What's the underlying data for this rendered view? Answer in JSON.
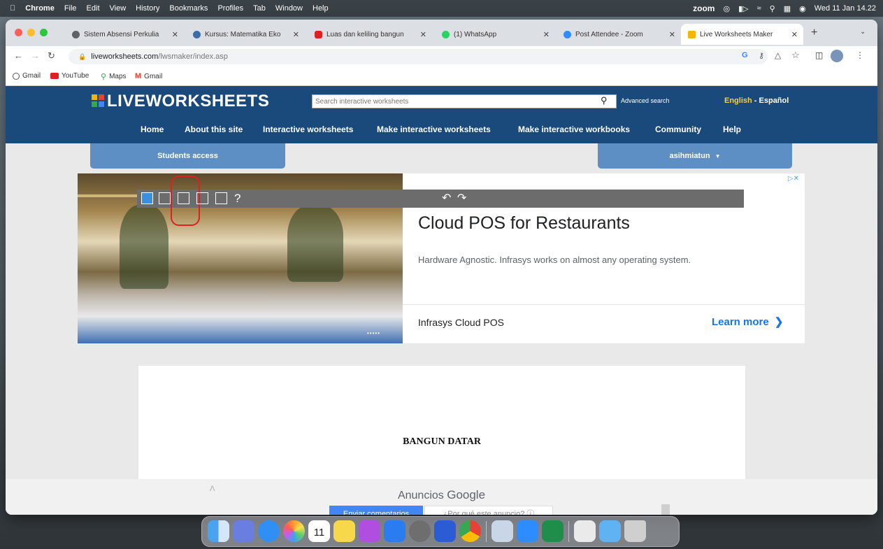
{
  "menubar": {
    "app": "Chrome",
    "items": [
      "File",
      "Edit",
      "View",
      "History",
      "Bookmarks",
      "Profiles",
      "Tab",
      "Window",
      "Help"
    ],
    "zoom_label": "zoom",
    "datetime": "Wed 11 Jan 14.22"
  },
  "tabs": [
    {
      "label": "Sistem Absensi Perkulia",
      "icon_color": "#5f6368"
    },
    {
      "label": "Kursus: Matematika Eko",
      "icon_color": "#3b6ea8"
    },
    {
      "label": "Luas dan keliling bangun",
      "icon_color": "#e02020"
    },
    {
      "label": "(1) WhatsApp",
      "icon_color": "#25d366"
    },
    {
      "label": "Post Attendee - Zoom",
      "icon_color": "#2d8cff"
    },
    {
      "label": "Live Worksheets Maker",
      "icon_color": "#f7b500",
      "active": true
    }
  ],
  "address": {
    "host": "liveworksheets.com",
    "path": "/lwsmaker/index.asp"
  },
  "bookmarks": [
    "Gmail",
    "YouTube",
    "Maps",
    "Gmail"
  ],
  "site": {
    "logo": "LIVEWORKSHEETS",
    "search_placeholder": "Search interactive worksheets",
    "advanced_search": "Advanced search",
    "lang_english": "English",
    "lang_sep": " - ",
    "lang_spanish": "Español",
    "nav": [
      "Home",
      "About this site",
      "Interactive worksheets",
      "Make interactive worksheets",
      "Make interactive workbooks",
      "Community",
      "Help"
    ],
    "students_access": "Students access",
    "user": "asihmiatun"
  },
  "ad": {
    "headline": "Cloud POS for Restaurants",
    "body": "Hardware Agnostic. Infrasys works on almost any operating system.",
    "brand": "Infrasys Cloud POS",
    "cta": "Learn more",
    "dots": "•••••"
  },
  "tools": {
    "help": "?"
  },
  "worksheet": {
    "title": "BANGUN DATAR"
  },
  "google_ad": {
    "label_prefix": "Anuncios ",
    "label_brand": "Google",
    "feedback": "Enviar comentarios",
    "why": "¿Por qué este anuncio? ⓘ"
  },
  "dock": {
    "calendar_day": "11",
    "icon_colors": [
      "#3f8de0",
      "#6a7de0",
      "#2f8ff5",
      "#ff9d2e",
      "#ffffff",
      "#f6d84a",
      "#b04ee0",
      "#2a7df0",
      "#6e6e6e",
      "#2b5cd6",
      "#e94235",
      "#c9d6e8",
      "#2d8cff",
      "#1f8e4a",
      "#eaeaea",
      "#5fb3f2",
      "#cfcfcf"
    ]
  }
}
